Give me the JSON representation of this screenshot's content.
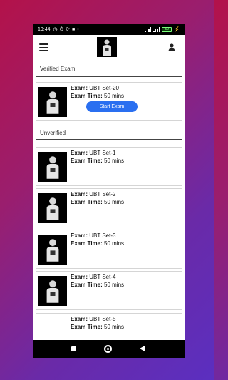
{
  "status_bar": {
    "time": "19:44",
    "battery": "59"
  },
  "sections": {
    "verified_title": "Verified Exam",
    "unverified_title": "Unverified"
  },
  "labels": {
    "exam_prefix": "Exam:",
    "time_prefix": "Exam Time:"
  },
  "verified_exams": [
    {
      "name": "UBT Set-20",
      "time": "50 mins",
      "button_label": "Start Exam"
    }
  ],
  "unverified_exams": [
    {
      "name": "UBT Set-1",
      "time": "50 mins"
    },
    {
      "name": "UBT Set-2",
      "time": "50 mins"
    },
    {
      "name": "UBT Set-3",
      "time": "50 mins"
    },
    {
      "name": "UBT Set-4",
      "time": "50 mins"
    },
    {
      "name": "UBT Set-5",
      "time": "50 mins"
    }
  ],
  "icons": {
    "menu": "hamburger-menu-icon",
    "profile": "user-icon"
  },
  "colors": {
    "accent": "#2a6ff0"
  }
}
